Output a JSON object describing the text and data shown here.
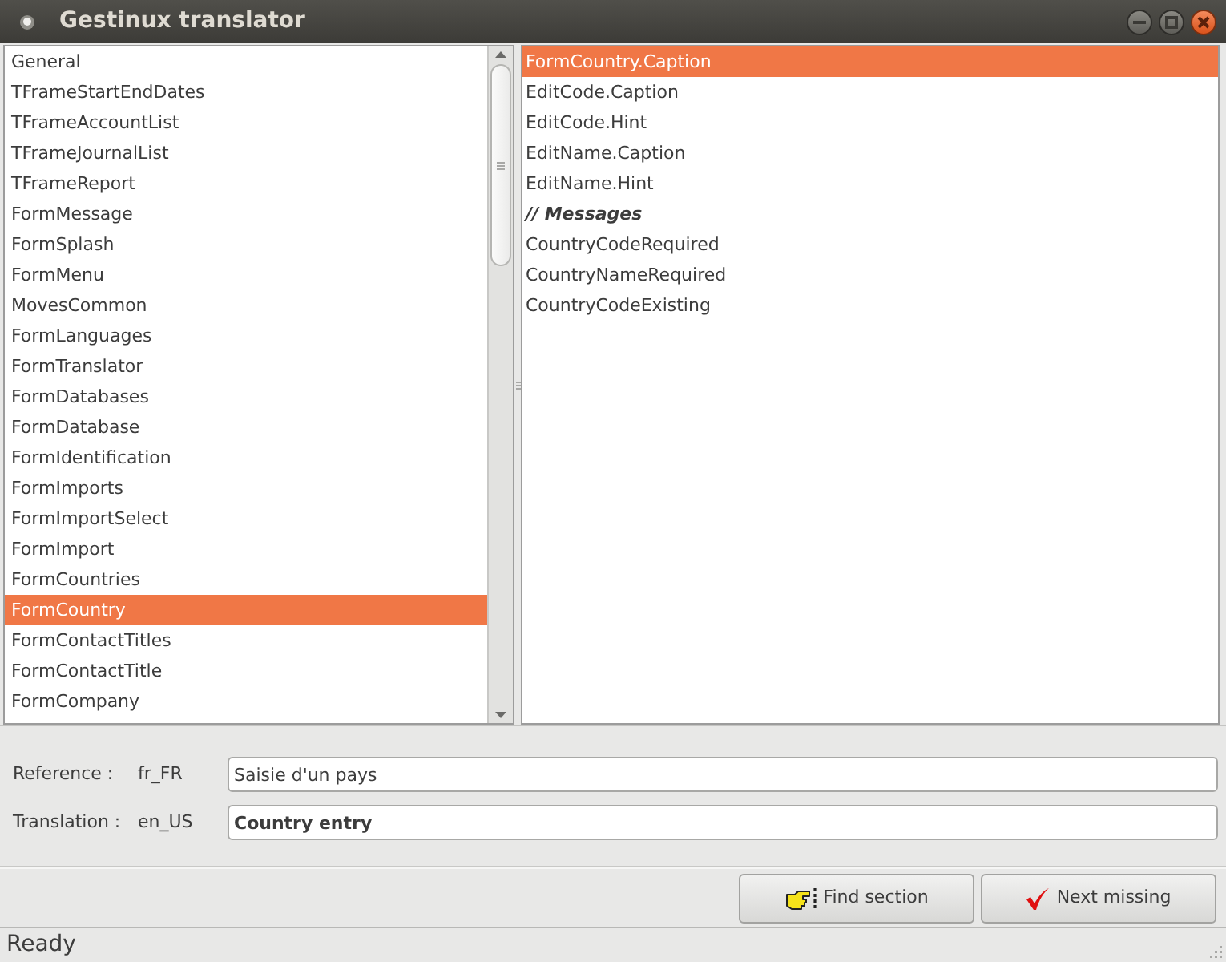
{
  "window": {
    "title": "Gestinux translator"
  },
  "sections": {
    "items": [
      {
        "label": "General",
        "selected": false
      },
      {
        "label": "TFrameStartEndDates",
        "selected": false
      },
      {
        "label": "TFrameAccountList",
        "selected": false
      },
      {
        "label": "TFrameJournalList",
        "selected": false
      },
      {
        "label": "TFrameReport",
        "selected": false
      },
      {
        "label": "FormMessage",
        "selected": false
      },
      {
        "label": "FormSplash",
        "selected": false
      },
      {
        "label": "FormMenu",
        "selected": false
      },
      {
        "label": "MovesCommon",
        "selected": false
      },
      {
        "label": "FormLanguages",
        "selected": false
      },
      {
        "label": "FormTranslator",
        "selected": false
      },
      {
        "label": "FormDatabases",
        "selected": false
      },
      {
        "label": "FormDatabase",
        "selected": false
      },
      {
        "label": "FormIdentification",
        "selected": false
      },
      {
        "label": "FormImports",
        "selected": false
      },
      {
        "label": "FormImportSelect",
        "selected": false
      },
      {
        "label": "FormImport",
        "selected": false
      },
      {
        "label": "FormCountries",
        "selected": false
      },
      {
        "label": "FormCountry",
        "selected": true
      },
      {
        "label": "FormContactTitles",
        "selected": false
      },
      {
        "label": "FormContactTitle",
        "selected": false
      },
      {
        "label": "FormCompany",
        "selected": false
      }
    ]
  },
  "keys": {
    "items": [
      {
        "label": "FormCountry.Caption",
        "kind": "key",
        "selected": true
      },
      {
        "label": "EditCode.Caption",
        "kind": "key",
        "selected": false
      },
      {
        "label": "EditCode.Hint",
        "kind": "key",
        "selected": false
      },
      {
        "label": "EditName.Caption",
        "kind": "key",
        "selected": false
      },
      {
        "label": "EditName.Hint",
        "kind": "key",
        "selected": false
      },
      {
        "label": "// Messages",
        "kind": "comment",
        "selected": false
      },
      {
        "label": "CountryCodeRequired",
        "kind": "key",
        "selected": false
      },
      {
        "label": "CountryNameRequired",
        "kind": "key",
        "selected": false
      },
      {
        "label": "CountryCodeExisting",
        "kind": "key",
        "selected": false
      }
    ]
  },
  "reference": {
    "label": "Reference :",
    "locale": "fr_FR",
    "value": "Saisie d'un pays"
  },
  "translation": {
    "label": "Translation :",
    "locale": "en_US",
    "value": "Country entry"
  },
  "buttons": [
    {
      "label": "Find section",
      "kind": "find"
    },
    {
      "label": "Next missing",
      "kind": "next"
    }
  ],
  "status_bar": {
    "text": "Ready"
  }
}
